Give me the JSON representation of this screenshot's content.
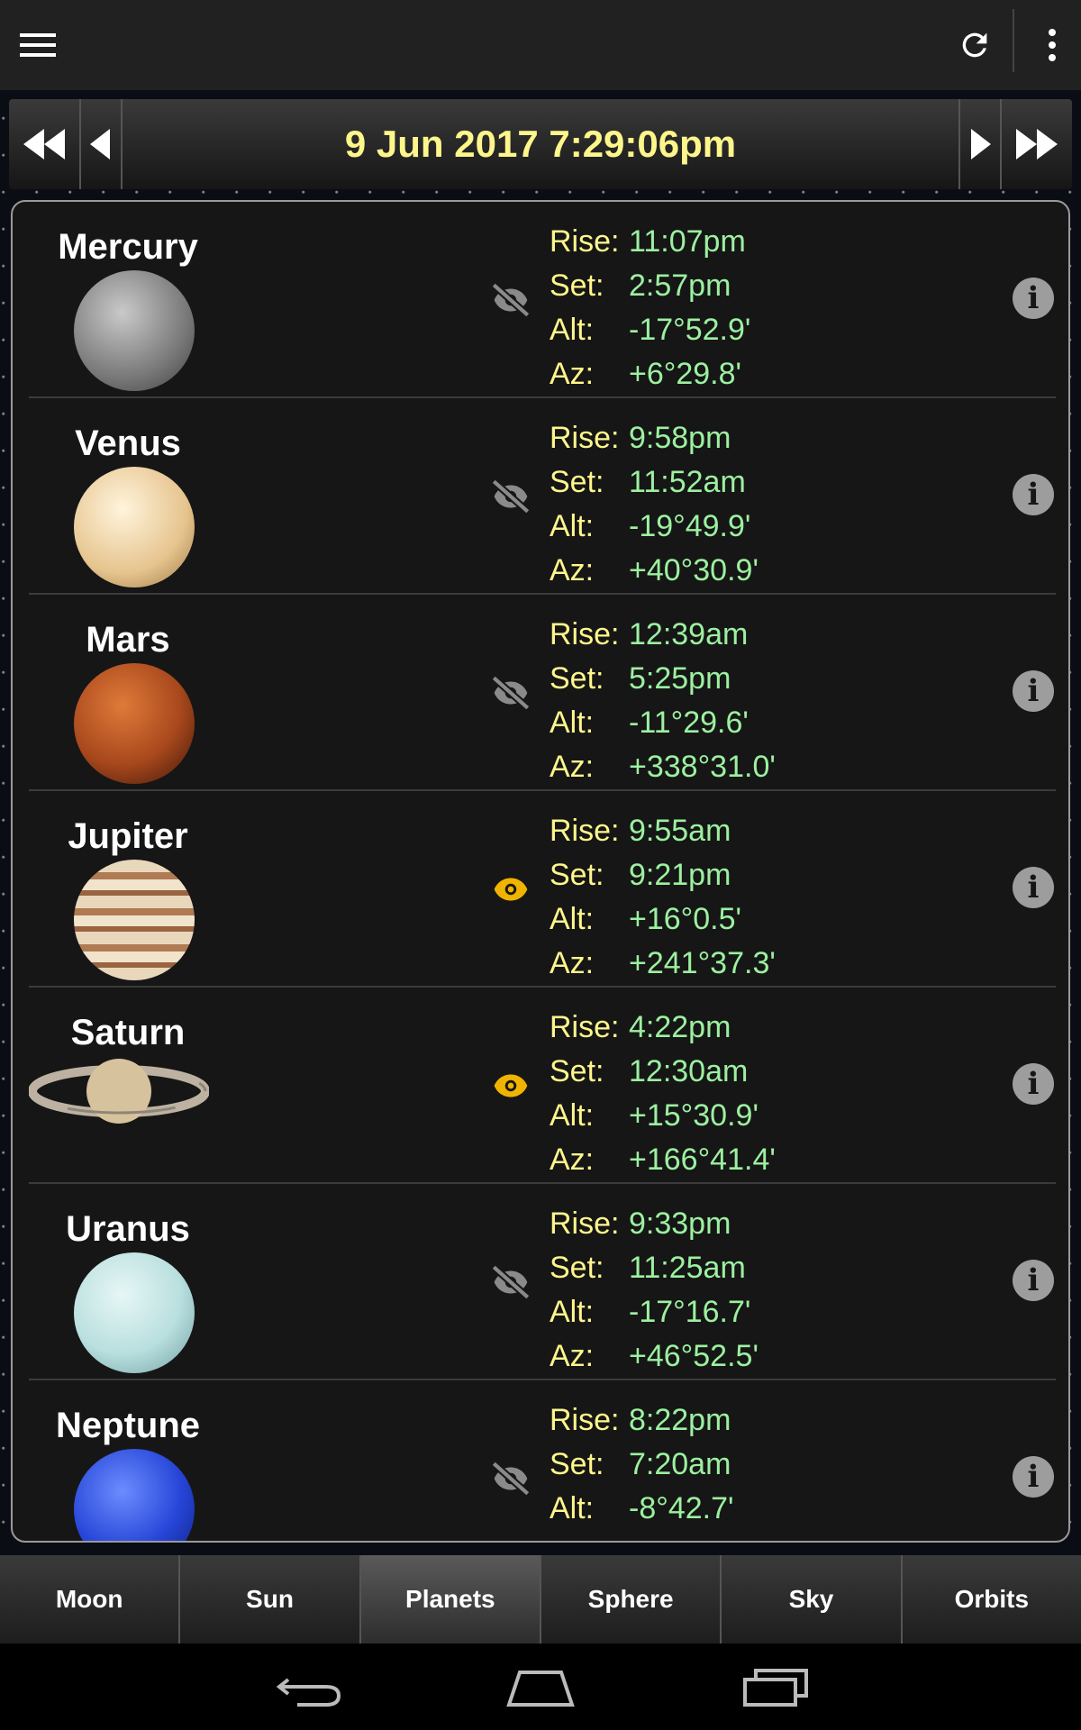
{
  "toolbar": {
    "menu_icon": "hamburger-menu-icon",
    "refresh_icon": "refresh-icon",
    "more_icon": "more-vertical-icon"
  },
  "date_nav": {
    "datetime": "9 Jun 2017 7:29:06pm"
  },
  "labels": {
    "rise": "Rise:",
    "set": "Set:",
    "alt": "Alt:",
    "az": "Az:"
  },
  "planets": [
    {
      "name": "Mercury",
      "visible": false,
      "rise": "11:07pm",
      "set": "2:57pm",
      "alt": "-17°52.9'",
      "az": "+6°29.8'"
    },
    {
      "name": "Venus",
      "visible": false,
      "rise": "9:58pm",
      "set": "11:52am",
      "alt": "-19°49.9'",
      "az": "+40°30.9'"
    },
    {
      "name": "Mars",
      "visible": false,
      "rise": "12:39am",
      "set": "5:25pm",
      "alt": "-11°29.6'",
      "az": "+338°31.0'"
    },
    {
      "name": "Jupiter",
      "visible": true,
      "rise": "9:55am",
      "set": "9:21pm",
      "alt": "+16°0.5'",
      "az": "+241°37.3'"
    },
    {
      "name": "Saturn",
      "visible": true,
      "rise": "4:22pm",
      "set": "12:30am",
      "alt": "+15°30.9'",
      "az": "+166°41.4'"
    },
    {
      "name": "Uranus",
      "visible": false,
      "rise": "9:33pm",
      "set": "11:25am",
      "alt": "-17°16.7'",
      "az": "+46°52.5'"
    },
    {
      "name": "Neptune",
      "visible": false,
      "rise": "8:22pm",
      "set": "7:20am",
      "alt": "-8°42.7'",
      "az": ""
    }
  ],
  "tabs": [
    "Moon",
    "Sun",
    "Planets",
    "Sphere",
    "Sky",
    "Orbits"
  ],
  "active_tab": "Planets",
  "colors": {
    "date": "#fff68b",
    "label": "#fff68b",
    "value": "#9cf0a0",
    "eye_visible": "#f0b400",
    "eye_hidden": "#8a8a8a"
  }
}
